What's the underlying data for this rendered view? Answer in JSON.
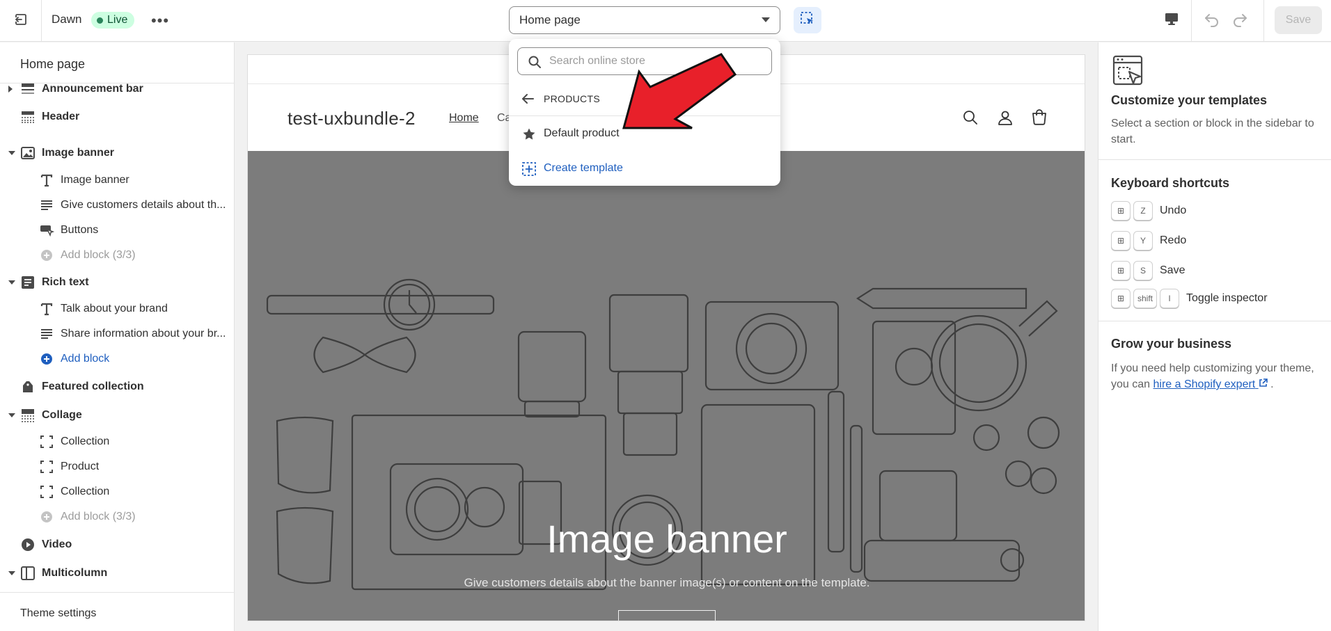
{
  "topbar": {
    "theme_name": "Dawn",
    "live_badge": "Live",
    "page_select_value": "Home page",
    "save_label": "Save"
  },
  "dropdown": {
    "search_placeholder": "Search online store",
    "back_label": "PRODUCTS",
    "items": [
      {
        "label": "Default product",
        "icon": "star-icon"
      },
      {
        "label": "Create template",
        "icon": "add-template-icon"
      }
    ]
  },
  "sidebar": {
    "title": "Home page",
    "rows": [
      {
        "type": "section",
        "label": "Announcement bar",
        "icon": "announcement-icon",
        "arrow": "right"
      },
      {
        "type": "section",
        "label": "Header",
        "icon": "header-icon",
        "arrow": "none"
      },
      {
        "type": "section",
        "label": "Image banner",
        "icon": "image-icon",
        "arrow": "down"
      },
      {
        "type": "block",
        "label": "Image banner",
        "icon": "text-icon"
      },
      {
        "type": "block",
        "label": "Give customers details about th...",
        "icon": "paragraph-icon"
      },
      {
        "type": "block",
        "label": "Buttons",
        "icon": "buttons-icon"
      },
      {
        "type": "add-muted",
        "label": "Add block (3/3)",
        "icon": "add-circle-icon"
      },
      {
        "type": "section",
        "label": "Rich text",
        "icon": "rich-text-icon",
        "arrow": "down"
      },
      {
        "type": "block",
        "label": "Talk about your brand",
        "icon": "text-icon"
      },
      {
        "type": "block",
        "label": "Share information about your br...",
        "icon": "paragraph-icon"
      },
      {
        "type": "add-active",
        "label": "Add block",
        "icon": "add-circle-icon"
      },
      {
        "type": "section",
        "label": "Featured collection",
        "icon": "collection-icon",
        "arrow": "none"
      },
      {
        "type": "section",
        "label": "Collage",
        "icon": "collage-icon",
        "arrow": "down"
      },
      {
        "type": "block",
        "label": "Collection",
        "icon": "frame-icon"
      },
      {
        "type": "block",
        "label": "Product",
        "icon": "frame-icon"
      },
      {
        "type": "block",
        "label": "Collection",
        "icon": "frame-icon"
      },
      {
        "type": "add-muted",
        "label": "Add block (3/3)",
        "icon": "add-circle-icon"
      },
      {
        "type": "section",
        "label": "Video",
        "icon": "video-icon",
        "arrow": "none"
      },
      {
        "type": "section",
        "label": "Multicolumn",
        "icon": "columns-icon",
        "arrow": "down"
      }
    ],
    "theme_settings": "Theme settings"
  },
  "preview": {
    "store_name": "test-uxbundle-2",
    "nav": [
      "Home",
      "Ca"
    ],
    "banner_heading": "Image banner",
    "banner_subtext": "Give customers details about the banner image(s) or content on the template."
  },
  "right_panel": {
    "title": "Customize your templates",
    "description": "Select a section or block in the sidebar to start.",
    "shortcuts_title": "Keyboard shortcuts",
    "shortcuts": [
      {
        "keys": [
          "⊞",
          "Z"
        ],
        "action": "Undo"
      },
      {
        "keys": [
          "⊞",
          "Y"
        ],
        "action": "Redo"
      },
      {
        "keys": [
          "⊞",
          "S"
        ],
        "action": "Save"
      },
      {
        "keys": [
          "⊞",
          "shift",
          "I"
        ],
        "action": "Toggle inspector"
      }
    ],
    "grow_title": "Grow your business",
    "grow_text_before": "If you need help customizing your theme, you can ",
    "grow_link": "hire a Shopify expert",
    "grow_text_after": " ."
  },
  "colors": {
    "accent_blue": "#1f5fbf",
    "live_badge_bg": "#cdfee1",
    "annotation_red": "#e8202a",
    "banner_bg": "#7c7c7c"
  }
}
